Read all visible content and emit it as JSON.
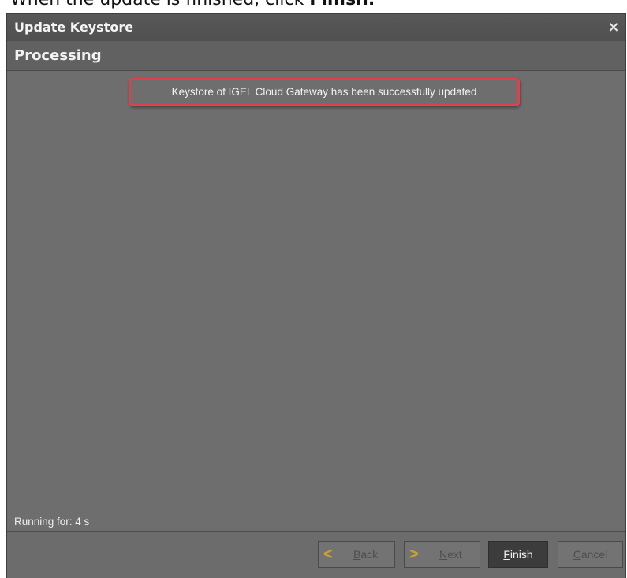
{
  "doc": {
    "text_prefix": "When the update is finished, click ",
    "text_bold": "Finish."
  },
  "window": {
    "title": "Update Keystore",
    "close_glyph": "×"
  },
  "header": {
    "title": "Processing"
  },
  "content": {
    "message": "Keystore of IGEL Cloud Gateway has been successfully updated"
  },
  "status": {
    "running_label": "Running for: 4 s"
  },
  "footer": {
    "back": {
      "first": "B",
      "rest": "ack",
      "icon": "chevron-left-icon"
    },
    "next": {
      "first": "N",
      "rest": "ext",
      "icon": "chevron-right-icon"
    },
    "finish": {
      "first": "F",
      "rest": "inish"
    },
    "cancel": {
      "first": "C",
      "rest": "ancel"
    }
  },
  "colors": {
    "dialog_bg": "#6d6d6d",
    "highlight": "#e0404c",
    "chevron": "#c9a13a",
    "primary_button": "#3c3c3c"
  }
}
